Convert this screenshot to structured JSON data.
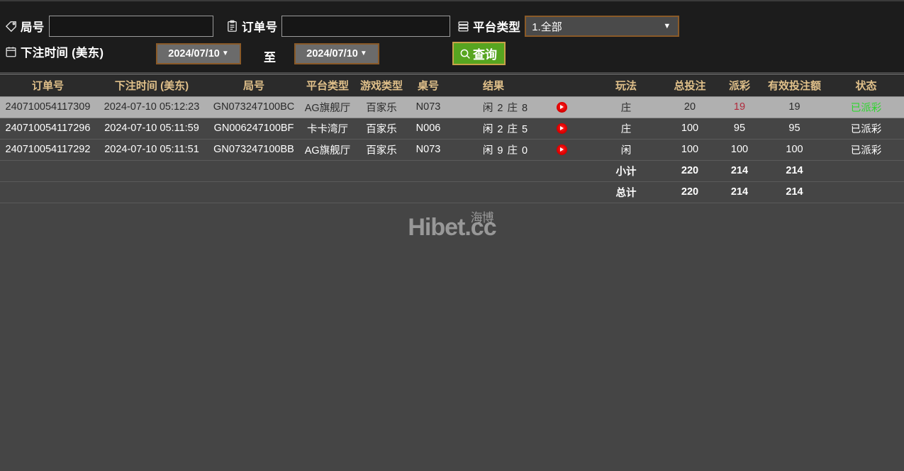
{
  "filters": {
    "round_no": {
      "label": "局号",
      "icon": "tag-icon",
      "value": "",
      "placeholder": ""
    },
    "order_no": {
      "label": "订单号",
      "icon": "clipboard-icon",
      "value": "",
      "placeholder": ""
    },
    "platform_type": {
      "label": "平台类型",
      "icon": "server-list-icon",
      "selected": "1.全部",
      "options": [
        "1.全部"
      ]
    },
    "bet_time": {
      "label": "下注时间 (美东)",
      "icon": "calendar-icon",
      "from": "2024/07/10",
      "to": "2024/07/10",
      "separator": "至"
    },
    "query_button": {
      "label": "查询",
      "icon": "search-icon",
      "color": "#57a520"
    }
  },
  "table": {
    "headers": [
      "订单号",
      "下注时间 (美东)",
      "局号",
      "平台类型",
      "游戏类型",
      "桌号",
      "结果",
      "玩法",
      "总投注",
      "派彩",
      "有效投注额",
      "状态"
    ],
    "rows": [
      {
        "order_no": "240710054117309",
        "bet_time": "2024-07-10 05:12:23",
        "round_no": "GN073247100BC",
        "platform": "AG旗舰厅",
        "game_type": "百家乐",
        "table_no": "N073",
        "result": "闲 2 庄 8",
        "replay_icon": "play-circle-icon",
        "play": "庄",
        "total_bet": "20",
        "payout": "19",
        "valid_bet": "19",
        "status": "已派彩",
        "highlighted": true
      },
      {
        "order_no": "240710054117296",
        "bet_time": "2024-07-10 05:11:59",
        "round_no": "GN006247100BF",
        "platform": "卡卡湾厅",
        "game_type": "百家乐",
        "table_no": "N006",
        "result": "闲 2 庄 5",
        "replay_icon": "play-circle-icon",
        "play": "庄",
        "total_bet": "100",
        "payout": "95",
        "valid_bet": "95",
        "status": "已派彩",
        "highlighted": false
      },
      {
        "order_no": "240710054117292",
        "bet_time": "2024-07-10 05:11:51",
        "round_no": "GN073247100BB",
        "platform": "AG旗舰厅",
        "game_type": "百家乐",
        "table_no": "N073",
        "result": "闲 9 庄 0",
        "replay_icon": "play-circle-icon",
        "play": "闲",
        "total_bet": "100",
        "payout": "100",
        "valid_bet": "100",
        "status": "已派彩",
        "highlighted": false
      }
    ],
    "subtotal": {
      "label": "小计",
      "total_bet": "220",
      "payout": "214",
      "valid_bet": "214"
    },
    "grandtotal": {
      "label": "总计",
      "total_bet": "220",
      "payout": "214",
      "valid_bet": "214"
    }
  },
  "watermark": {
    "main": "Hibet.cc",
    "cn": "海博"
  },
  "colors": {
    "header_text": "#e0c08a",
    "payout": "#e3384f",
    "status": "#25e625",
    "summary": "#ecec3d",
    "query_green": "#57a520",
    "accent_border": "#8a5a28"
  }
}
